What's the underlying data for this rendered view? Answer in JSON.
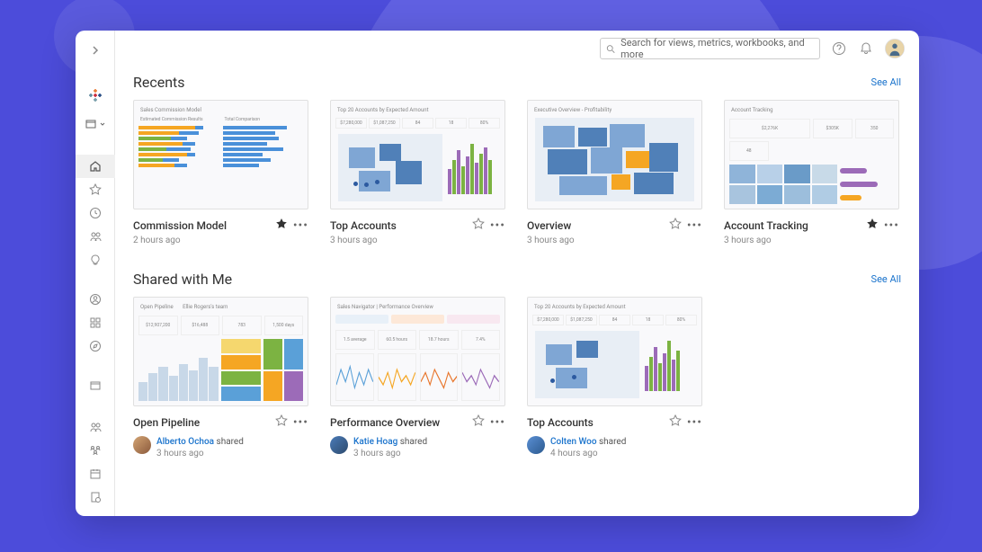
{
  "topbar": {
    "search_placeholder": "Search for views, metrics, workbooks, and more"
  },
  "sections": {
    "recents": {
      "title": "Recents",
      "see_all": "See All"
    },
    "shared": {
      "title": "Shared with Me",
      "see_all": "See All"
    }
  },
  "recents": [
    {
      "title": "Commission Model",
      "sub": "2 hours ago",
      "starred": true
    },
    {
      "title": "Top Accounts",
      "sub": "3 hours ago",
      "starred": false
    },
    {
      "title": "Overview",
      "sub": "3 hours ago",
      "starred": false
    },
    {
      "title": "Account Tracking",
      "sub": "3 hours ago",
      "starred": true
    }
  ],
  "shared": [
    {
      "title": "Open Pipeline",
      "by": "Alberto Ochoa",
      "word": "shared",
      "time": "3 hours ago"
    },
    {
      "title": "Performance Overview",
      "by": "Katie Hoag",
      "word": "shared",
      "time": "3 hours ago"
    },
    {
      "title": "Top Accounts",
      "by": "Colten Woo",
      "word": "shared",
      "time": "4 hours ago"
    }
  ]
}
